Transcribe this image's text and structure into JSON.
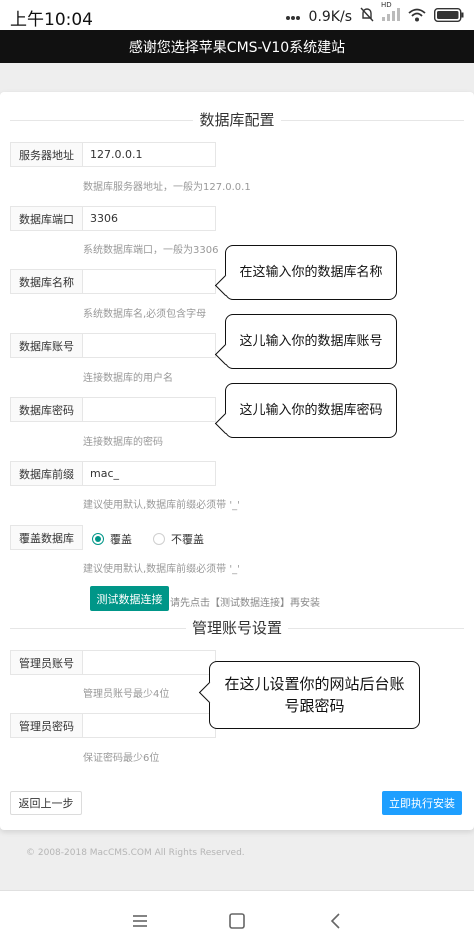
{
  "status_bar": {
    "time": "上午10:04",
    "speed": "0.9K/s",
    "network_label": "HD",
    "icons": [
      "dots-icon",
      "mute-icon",
      "signal-icon",
      "wifi-icon",
      "battery-icon"
    ]
  },
  "header": {
    "title": "感谢您选择苹果CMS-V10系统建站"
  },
  "db_section": {
    "title": "数据库配置",
    "fields": [
      {
        "label": "服务器地址",
        "value": "127.0.0.1",
        "hint": "数据库服务器地址，一般为127.0.0.1"
      },
      {
        "label": "数据库端口",
        "value": "3306",
        "hint": "系统数据库端口，一般为3306"
      },
      {
        "label": "数据库名称",
        "value": "",
        "hint": "系统数据库名,必须包含字母"
      },
      {
        "label": "数据库账号",
        "value": "",
        "hint": "连接数据库的用户名"
      },
      {
        "label": "数据库密码",
        "value": "",
        "hint": "连接数据库的密码"
      },
      {
        "label": "数据库前缀",
        "value": "mac_",
        "hint": "建议使用默认,数据库前缀必须带 '_'"
      }
    ],
    "overwrite": {
      "label": "覆盖数据库",
      "options": [
        {
          "label": "覆盖",
          "selected": true
        },
        {
          "label": "不覆盖",
          "selected": false
        }
      ],
      "hint": "建议使用默认,数据库前缀必须带 '_'"
    },
    "test_button": "测试数据连接",
    "test_hint": "请先点击【测试数据连接】再安装"
  },
  "admin_section": {
    "title": "管理账号设置",
    "fields": [
      {
        "label": "管理员账号",
        "value": "",
        "hint": "管理员账号最少4位"
      },
      {
        "label": "管理员密码",
        "value": "",
        "hint": "保证密码最少6位"
      }
    ]
  },
  "actions": {
    "back": "返回上一步",
    "install": "立即执行安装"
  },
  "annotations": {
    "db_name": "在这输入你的数据库名称",
    "db_user": "这儿输入你的数据库账号",
    "db_pass": "这儿输入你的数据库密码",
    "admin": "在这儿设置你的网站后台账号跟密码"
  },
  "footer": {
    "copyright": "© 2008-2018 MacCMS.COM All Rights Reserved."
  },
  "colors": {
    "primary_button": "#009688",
    "install_button": "#1e9fff",
    "header_bg": "#111111"
  }
}
